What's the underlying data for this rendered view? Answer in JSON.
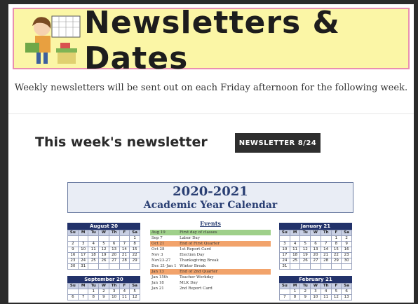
{
  "banner": {
    "title": "Newsletters & Dates"
  },
  "intro": "Weekly newsletters will be sent out on each Friday afternoon for the following week.",
  "section_title": "This week's newsletter",
  "newsletter_button": "NEWSLETTER 8/24",
  "calendar": {
    "year": "2020-2021",
    "subtitle": "Academic Year Calendar",
    "events_heading": "Events",
    "day_headers": [
      "Su",
      "M",
      "Tu",
      "W",
      "Th",
      "F",
      "Sa"
    ],
    "months": [
      {
        "name": "August 20",
        "rows": [
          [
            "",
            "",
            "",
            "",
            "",
            "",
            "1"
          ],
          [
            "2",
            "3",
            "4",
            "5",
            "6",
            "7",
            "8"
          ],
          [
            "9",
            "10",
            "11",
            "12",
            "13",
            "14",
            "15"
          ],
          [
            "16",
            "17",
            "18",
            "19",
            "20",
            "21",
            "22"
          ],
          [
            "23",
            "24",
            "25",
            "26",
            "27",
            "28",
            "29"
          ],
          [
            "30",
            "31",
            "",
            "",
            "",
            "",
            ""
          ]
        ]
      },
      {
        "name": "January 21",
        "rows": [
          [
            "",
            "",
            "",
            "",
            "",
            "1",
            "2"
          ],
          [
            "3",
            "4",
            "5",
            "6",
            "7",
            "8",
            "9"
          ],
          [
            "10",
            "11",
            "12",
            "13",
            "14",
            "15",
            "16"
          ],
          [
            "17",
            "18",
            "19",
            "20",
            "21",
            "22",
            "23"
          ],
          [
            "24",
            "25",
            "26",
            "27",
            "28",
            "29",
            "30"
          ],
          [
            "31",
            "",
            "",
            "",
            "",
            "",
            ""
          ]
        ]
      },
      {
        "name": "September 20",
        "rows": [
          [
            "",
            "",
            "1",
            "2",
            "3",
            "4",
            "5"
          ],
          [
            "6",
            "7",
            "8",
            "9",
            "10",
            "11",
            "12"
          ]
        ]
      },
      {
        "name": "February 21",
        "rows": [
          [
            "",
            "1",
            "2",
            "3",
            "4",
            "5",
            "6"
          ],
          [
            "7",
            "8",
            "9",
            "10",
            "11",
            "12",
            "13"
          ]
        ]
      }
    ],
    "events": [
      {
        "date": "Aug 19",
        "name": "First day of classes",
        "color": "#9fd08a"
      },
      {
        "date": "Sep 7",
        "name": "Labor Day",
        "color": ""
      },
      {
        "date": "Oct 21",
        "name": "End of First Quarter",
        "color": "#f2a36b"
      },
      {
        "date": "Oct 28",
        "name": "1st Report Card",
        "color": ""
      },
      {
        "date": "Nov 3",
        "name": "Election Day",
        "color": ""
      },
      {
        "date": "Nov23-27",
        "name": "Thanksgiving Break",
        "color": ""
      },
      {
        "date": "Dec 21-Jan 1",
        "name": "Winter Break",
        "color": ""
      },
      {
        "date": "Jan 13",
        "name": "End of 2nd Quarter",
        "color": "#f2a36b"
      },
      {
        "date": "Jan 15th",
        "name": "Teacher Workday",
        "color": ""
      },
      {
        "date": "Jan 18",
        "name": "MLK Day",
        "color": ""
      },
      {
        "date": "Jan 21",
        "name": "2nd Report Card",
        "color": ""
      }
    ]
  }
}
